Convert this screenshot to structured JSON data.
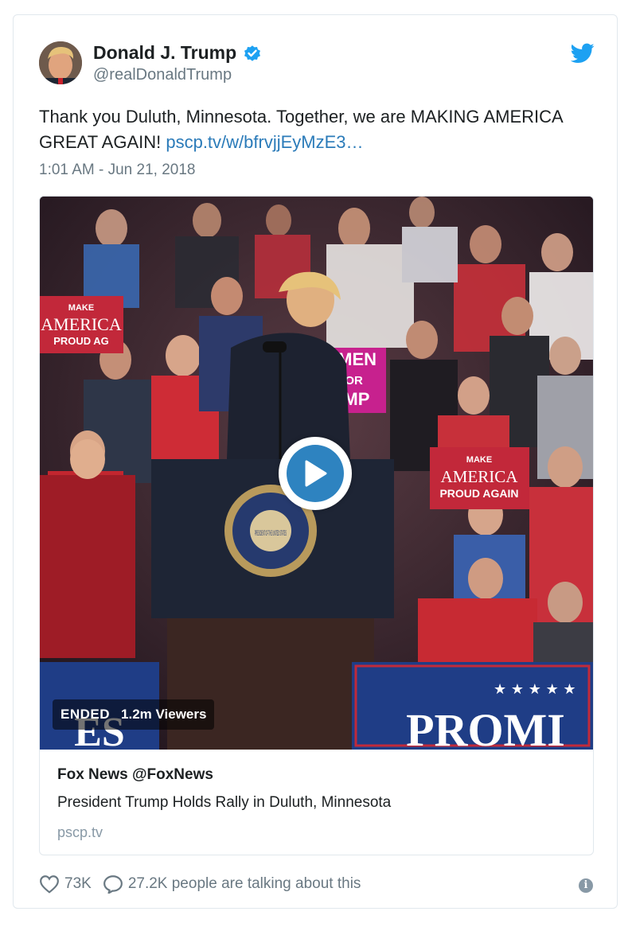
{
  "tweet": {
    "author_name": "Donald J. Trump",
    "handle": "@realDonaldTrump",
    "text_main": "Thank you Duluth, Minnesota. Together, we are MAKING AMERICA GREAT AGAIN! ",
    "text_link": "pscp.tv/w/bfrvjjEyMzE3…",
    "timestamp": "1:01 AM - Jun 21, 2018",
    "icons": [
      "verified-badge-icon",
      "twitter-bird-icon"
    ]
  },
  "embed": {
    "status": "ENDED",
    "viewers": "1.2m Viewers",
    "source": "Fox News @FoxNews",
    "title": "President Trump Holds Rally in Duluth, Minnesota",
    "domain": "pscp.tv",
    "signs": {
      "left_sign": [
        "MAKE",
        "AMERICA",
        "PROUD AG"
      ],
      "center_sign": [
        "OMEN",
        "FOR",
        "UMP"
      ],
      "right_sign": [
        "MAKE",
        "AMERICA",
        "PROUD AGAIN"
      ],
      "banner": "PROMI",
      "banner_left": "ES",
      "seal_text": "PRESIDENT OF THE UNITED STATES"
    }
  },
  "footer": {
    "likes": "73K",
    "talking": "27.2K people are talking about this",
    "info_icon": "i"
  },
  "colors": {
    "link": "#2b7bb9",
    "verified": "#1da1f2",
    "play": "#2e83c0",
    "muted": "#697882"
  }
}
